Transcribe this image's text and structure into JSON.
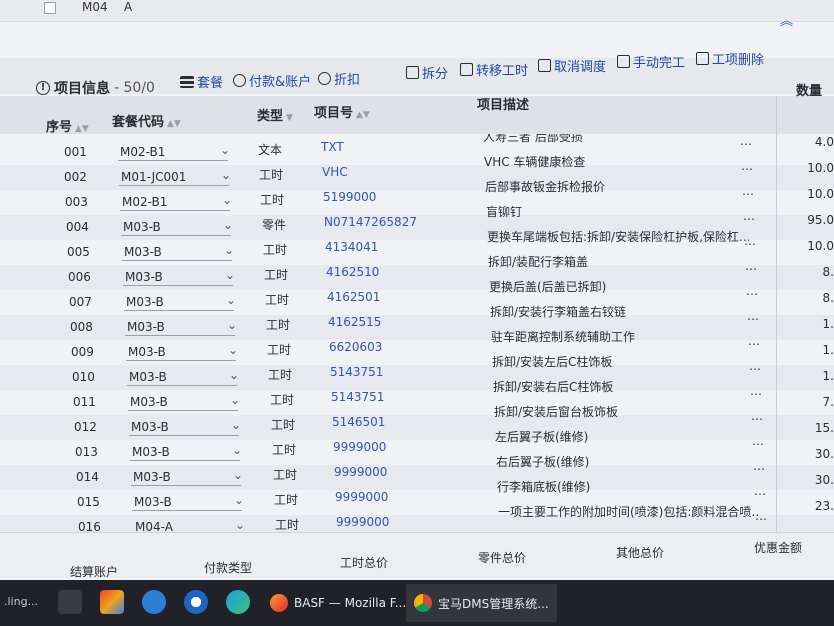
{
  "top_partial_row": {
    "code": "M04",
    "sub": "A"
  },
  "toolbar": {
    "info_label": "项目信息",
    "count": "- 50/0",
    "buttons": [
      {
        "label": "套餐",
        "icon": "layers-icon"
      },
      {
        "label": "付款&账户",
        "icon": "payment-icon"
      },
      {
        "label": "折扣",
        "icon": "discount-icon"
      },
      {
        "label": "拆分",
        "icon": "split-icon"
      },
      {
        "label": "转移工时",
        "icon": "transfer-icon"
      },
      {
        "label": "取消调度",
        "icon": "cancel-schedule-icon"
      },
      {
        "label": "手动完工",
        "icon": "manual-complete-icon"
      },
      {
        "label": "工项删除",
        "icon": "delete-icon"
      }
    ]
  },
  "columns": {
    "seq": "序号",
    "package_code": "套餐代码",
    "type": "类型",
    "item_no": "项目号",
    "description": "项目描述",
    "quantity": "数量"
  },
  "rows": [
    {
      "seq": "001",
      "pkg": "M02-B1",
      "type": "文本",
      "item": "TXT",
      "desc": "人寿三者 后部受损",
      "qty": "4.0"
    },
    {
      "seq": "002",
      "pkg": "M01-JC001",
      "type": "工时",
      "item": "VHC",
      "desc": "VHC 车辆健康检查",
      "qty": "10.0"
    },
    {
      "seq": "003",
      "pkg": "M02-B1",
      "type": "工时",
      "item": "5199000",
      "desc": "后部事故钣金拆检报价",
      "qty": "10.0"
    },
    {
      "seq": "004",
      "pkg": "M03-B",
      "type": "零件",
      "item": "N07147265827",
      "desc": "盲铆钉",
      "qty": "95.0"
    },
    {
      "seq": "005",
      "pkg": "M03-B",
      "type": "工时",
      "item": "4134041",
      "desc": "更换车尾端板包括:拆卸/安装保险杠护板,保险杠…",
      "qty": "10.0"
    },
    {
      "seq": "006",
      "pkg": "M03-B",
      "type": "工时",
      "item": "4162510",
      "desc": "拆卸/装配行李箱盖",
      "qty": "8."
    },
    {
      "seq": "007",
      "pkg": "M03-B",
      "type": "工时",
      "item": "4162501",
      "desc": "更换后盖(后盖已拆卸)",
      "qty": "8."
    },
    {
      "seq": "008",
      "pkg": "M03-B",
      "type": "工时",
      "item": "4162515",
      "desc": "拆卸/安装行李箱盖右铰链",
      "qty": "1."
    },
    {
      "seq": "009",
      "pkg": "M03-B",
      "type": "工时",
      "item": "6620603",
      "desc": "驻车距离控制系统辅助工作",
      "qty": "1."
    },
    {
      "seq": "010",
      "pkg": "M03-B",
      "type": "工时",
      "item": "5143751",
      "desc": "拆卸/安装左后C柱饰板",
      "qty": "1."
    },
    {
      "seq": "011",
      "pkg": "M03-B",
      "type": "工时",
      "item": "5143751",
      "desc": "拆卸/安装右后C柱饰板",
      "qty": "7."
    },
    {
      "seq": "012",
      "pkg": "M03-B",
      "type": "工时",
      "item": "5146501",
      "desc": "拆卸/安装后窗台板饰板",
      "qty": "15."
    },
    {
      "seq": "013",
      "pkg": "M03-B",
      "type": "工时",
      "item": "9999000",
      "desc": "左后翼子板(维修)",
      "qty": "30."
    },
    {
      "seq": "014",
      "pkg": "M03-B",
      "type": "工时",
      "item": "9999000",
      "desc": "右后翼子板(维修)",
      "qty": "30."
    },
    {
      "seq": "015",
      "pkg": "M03-B",
      "type": "工时",
      "item": "9999000",
      "desc": "行李箱底板(维修)",
      "qty": "23."
    },
    {
      "seq": "016",
      "pkg": "M04-A",
      "type": "工时",
      "item": "9999000",
      "desc": "一项主要工作的附加时间(喷漆)包括:颜料混合喷…",
      "qty": ""
    }
  ],
  "summary": {
    "settle_account": "结算账户",
    "payment_type": "付款类型",
    "labor_total": "工时总价",
    "parts_total": "零件总价",
    "other_total": "其他总价",
    "discount_amount": "优惠金额"
  },
  "taskbar": {
    "left_text": ".ling...",
    "apps": [
      {
        "label": "BASF — Mozilla F...",
        "icon": "firefox-icon"
      },
      {
        "label": "宝马DMS管理系统...",
        "icon": "chrome-icon"
      }
    ]
  },
  "colors": {
    "link": "#2f55b8",
    "toolbar_btn": "#1f49a4",
    "taskbar": "#202228"
  }
}
